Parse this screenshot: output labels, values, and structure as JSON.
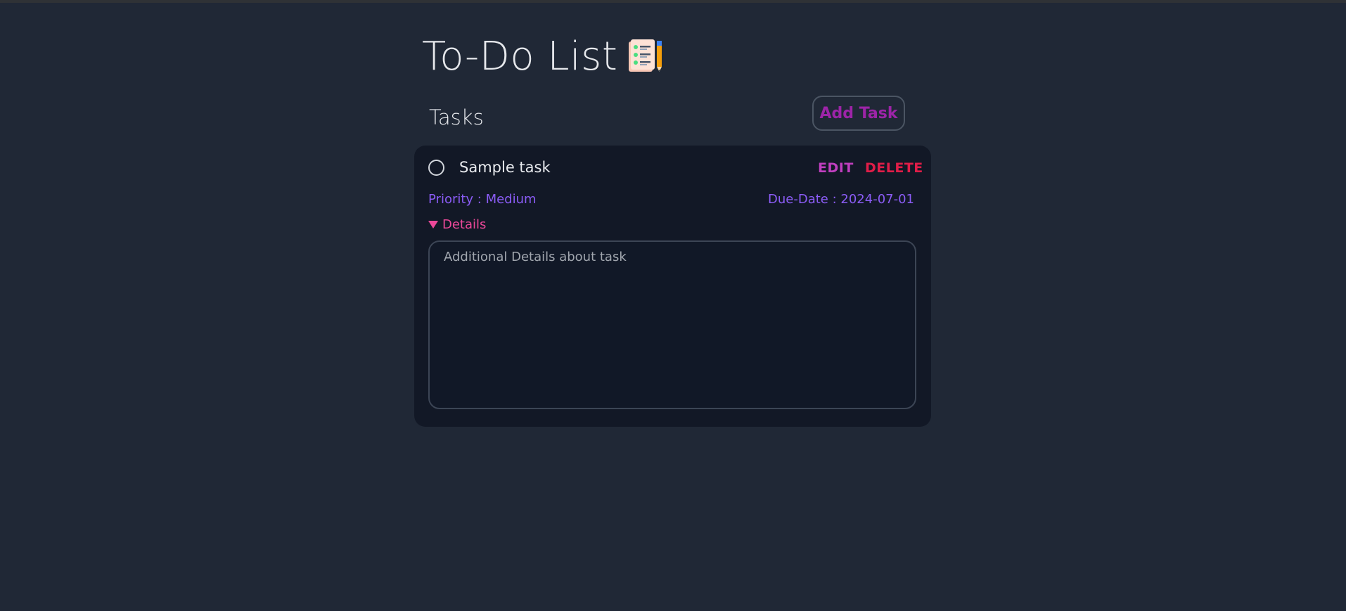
{
  "header": {
    "title": "To-Do List",
    "title_icon": "clipboard-checklist-pencil-icon"
  },
  "tasks_section": {
    "title": "Tasks",
    "add_button_label": "Add Task"
  },
  "task": {
    "name": "Sample task",
    "completed": false,
    "edit_label": "EDIT",
    "delete_label": "DELETE",
    "priority_text": "Priority : Medium",
    "due_date_text": "Due-Date : 2024-07-01",
    "details_label": "Details",
    "details_placeholder": "Additional Details about task",
    "details_value": ""
  },
  "colors": {
    "background": "#202836",
    "card": "#121826",
    "accent_purple": "#8b5cf6",
    "accent_pink": "#ec4899",
    "edit": "#c03fbf",
    "delete": "#e11d48",
    "add_task": "#9d24a8"
  }
}
